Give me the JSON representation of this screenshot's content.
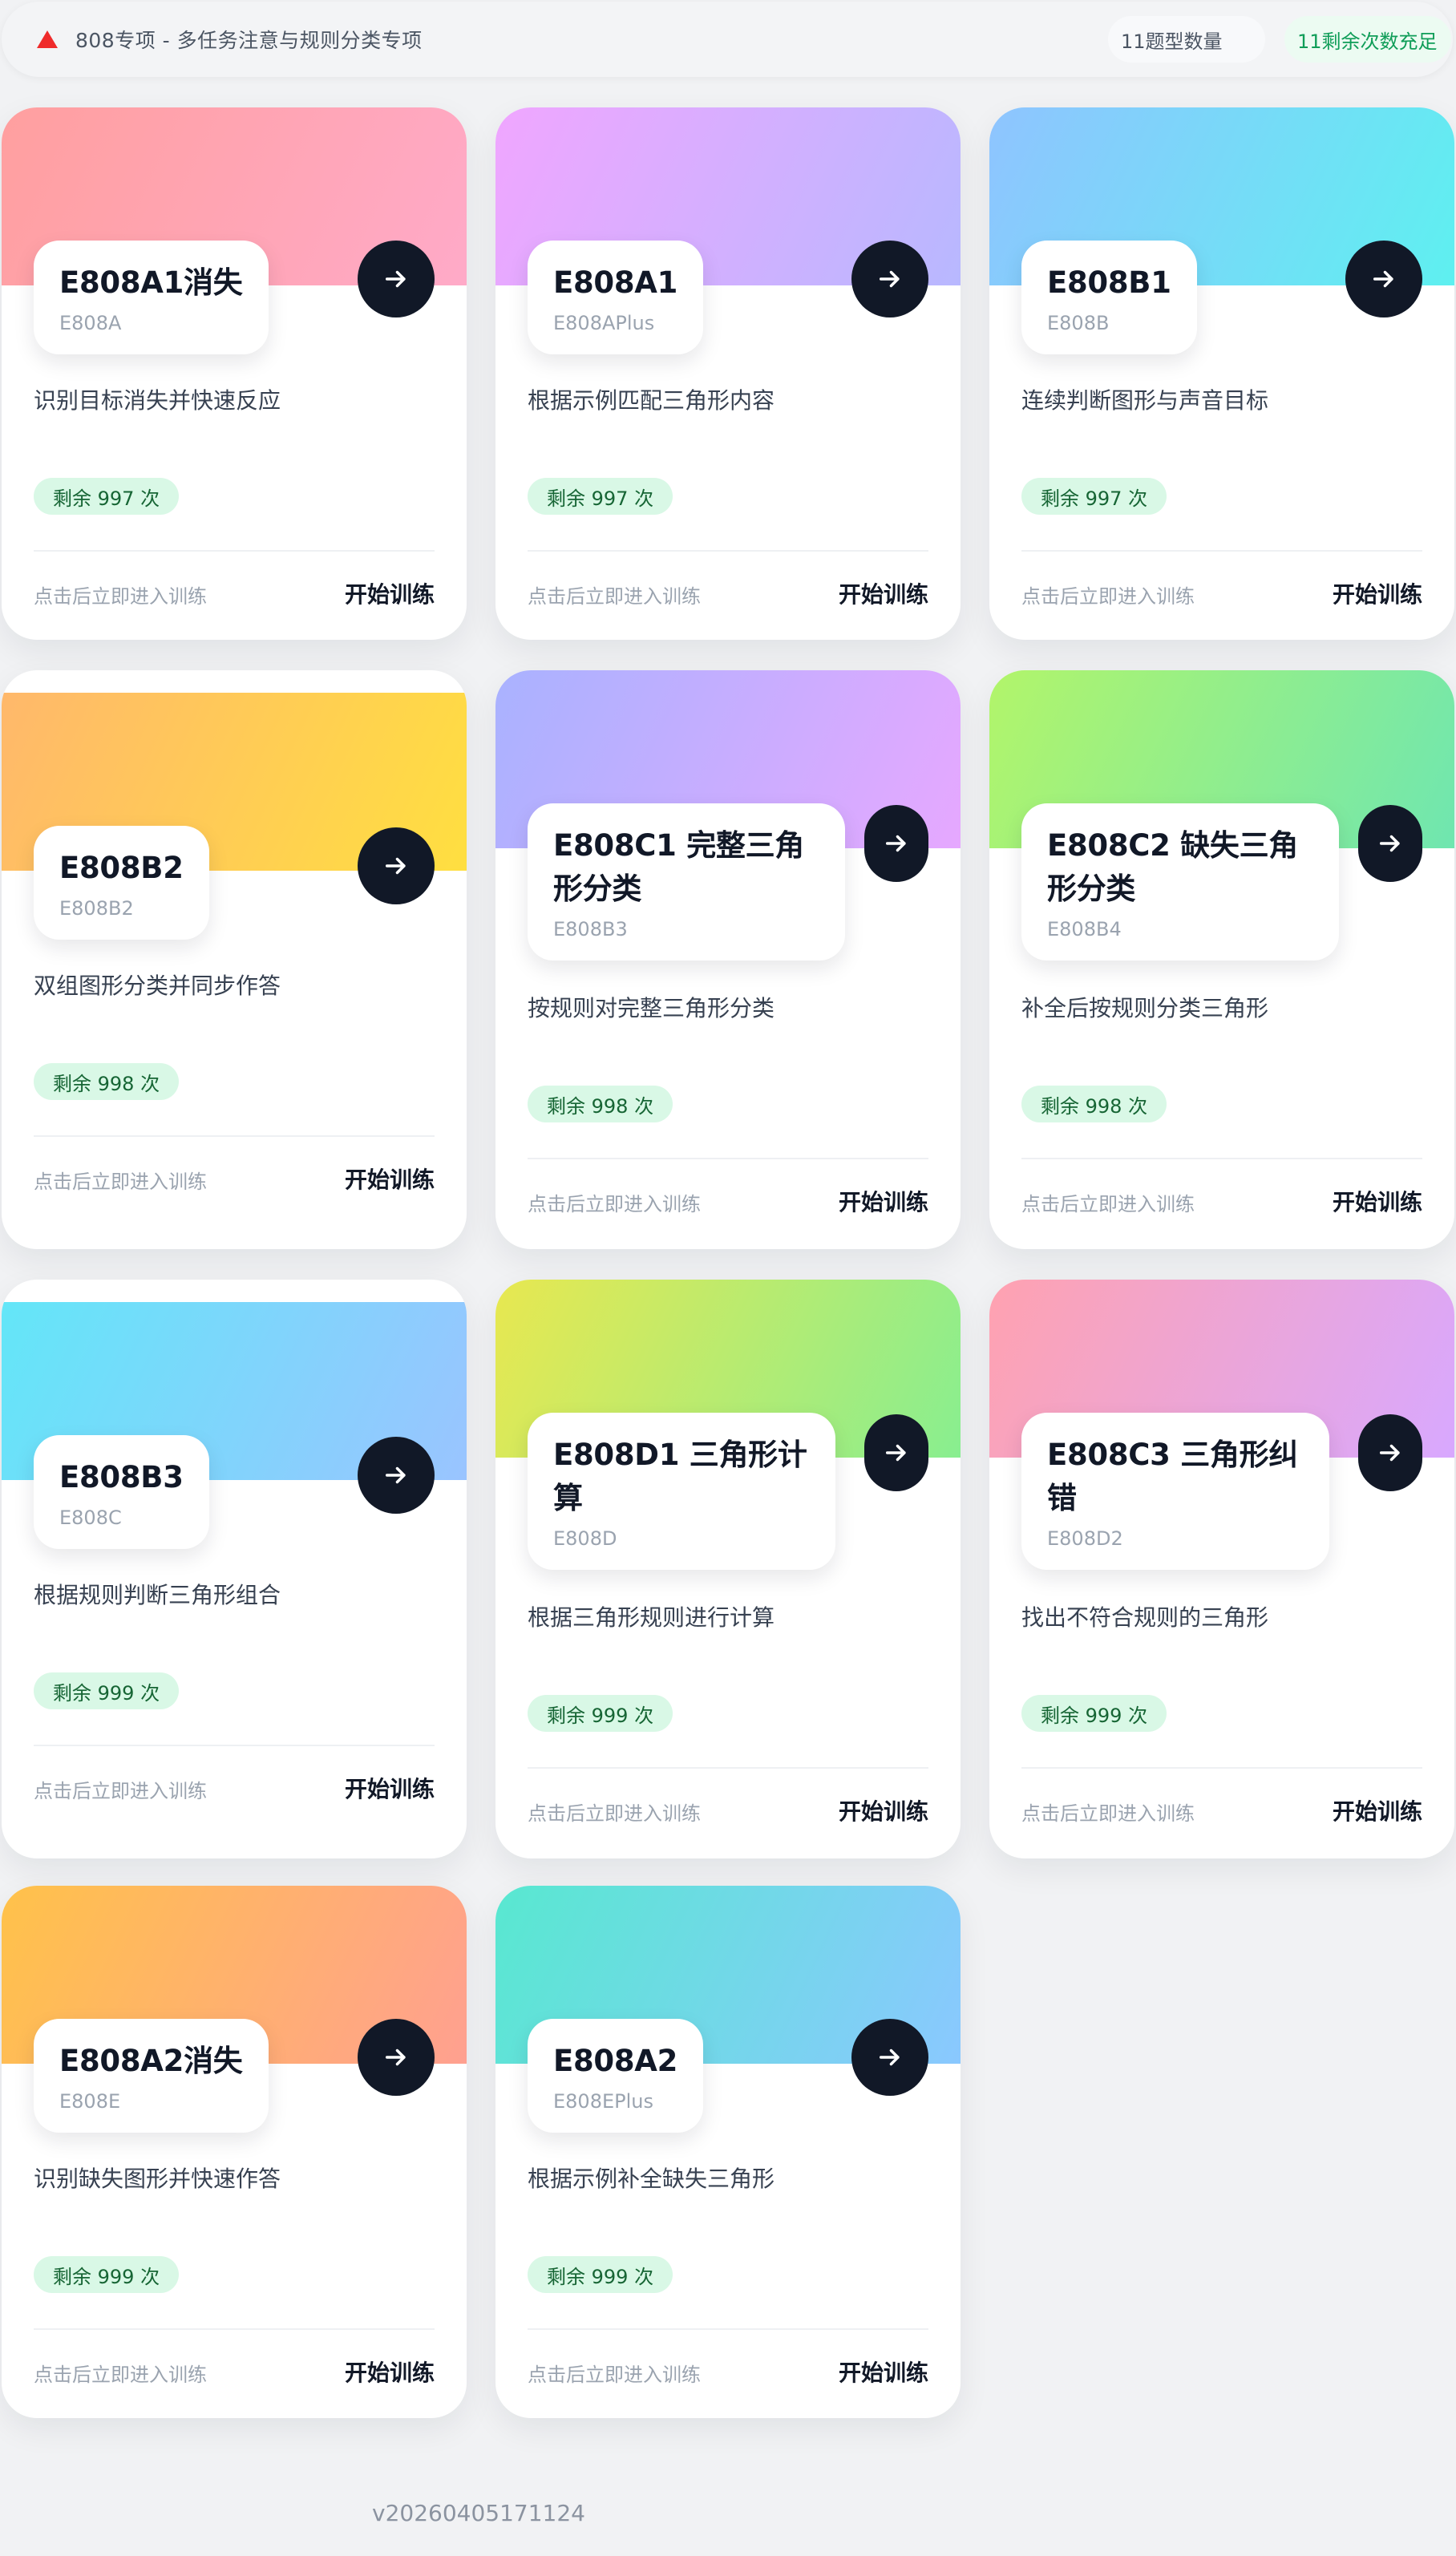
{
  "header": {
    "title": "808专项 - 多任务注意与规则分类专项",
    "count_pill": "11题型数量",
    "status_pill": "11剩余次数充足"
  },
  "common": {
    "hint": "点击后立即进入训练",
    "start_label": "开始训练"
  },
  "cards": [
    {
      "name": "E808A1消失",
      "code": "E808A",
      "desc": "识别目标消失并快速反应",
      "remaining": "剩余 997 次",
      "banner_from": "#ff9f9f",
      "banner_to": "#ffaac8"
    },
    {
      "name": "E808A1",
      "code": "E808APlus",
      "desc": "根据示例匹配三角形内容",
      "remaining": "剩余 997 次",
      "banner_from": "#f0a6ff",
      "banner_to": "#b8b8ff"
    },
    {
      "name": "E808B1",
      "code": "E808B",
      "desc": "连续判断图形与声音目标",
      "remaining": "剩余 997 次",
      "banner_from": "#8fc4ff",
      "banner_to": "#5ef0f0"
    },
    {
      "name": "E808B2",
      "code": "E808B2",
      "desc": "双组图形分类并同步作答",
      "remaining": "剩余 998 次",
      "banner_from": "#ffb86b",
      "banner_to": "#ffdf40"
    },
    {
      "name": "E808C1 完整三角形分类",
      "code": "E808B3",
      "desc": "按规则对完整三角形分类",
      "remaining": "剩余 998 次",
      "banner_from": "#a9b2ff",
      "banner_to": "#e6a8ff"
    },
    {
      "name": "E808C2 缺失三角形分类",
      "code": "E808B4",
      "desc": "补全后按规则分类三角形",
      "remaining": "剩余 998 次",
      "banner_from": "#b2f56a",
      "banner_to": "#6fe6b0"
    },
    {
      "name": "E808B3",
      "code": "E808C",
      "desc": "根据规则判断三角形组合",
      "remaining": "剩余 999 次",
      "banner_from": "#63e6f8",
      "banner_to": "#9ac4ff"
    },
    {
      "name": "E808D1 三角形计算",
      "code": "E808D",
      "desc": "根据三角形规则进行计算",
      "remaining": "剩余 999 次",
      "banner_from": "#e8e850",
      "banner_to": "#88ee90"
    },
    {
      "name": "E808C3 三角形纠错",
      "code": "E808D2",
      "desc": "找出不符合规则的三角形",
      "remaining": "剩余 999 次",
      "banner_from": "#ffa2b0",
      "banner_to": "#d8a8ff"
    },
    {
      "name": "E808A2消失",
      "code": "E808E",
      "desc": "识别缺失图形并快速作答",
      "remaining": "剩余 999 次",
      "banner_from": "#ffc24a",
      "banner_to": "#ffa090"
    },
    {
      "name": "E808A2",
      "code": "E808EPlus",
      "desc": "根据示例补全缺失三角形",
      "remaining": "剩余 999 次",
      "banner_from": "#58e8d0",
      "banner_to": "#8ac8ff"
    }
  ],
  "version": "v20260405171124"
}
